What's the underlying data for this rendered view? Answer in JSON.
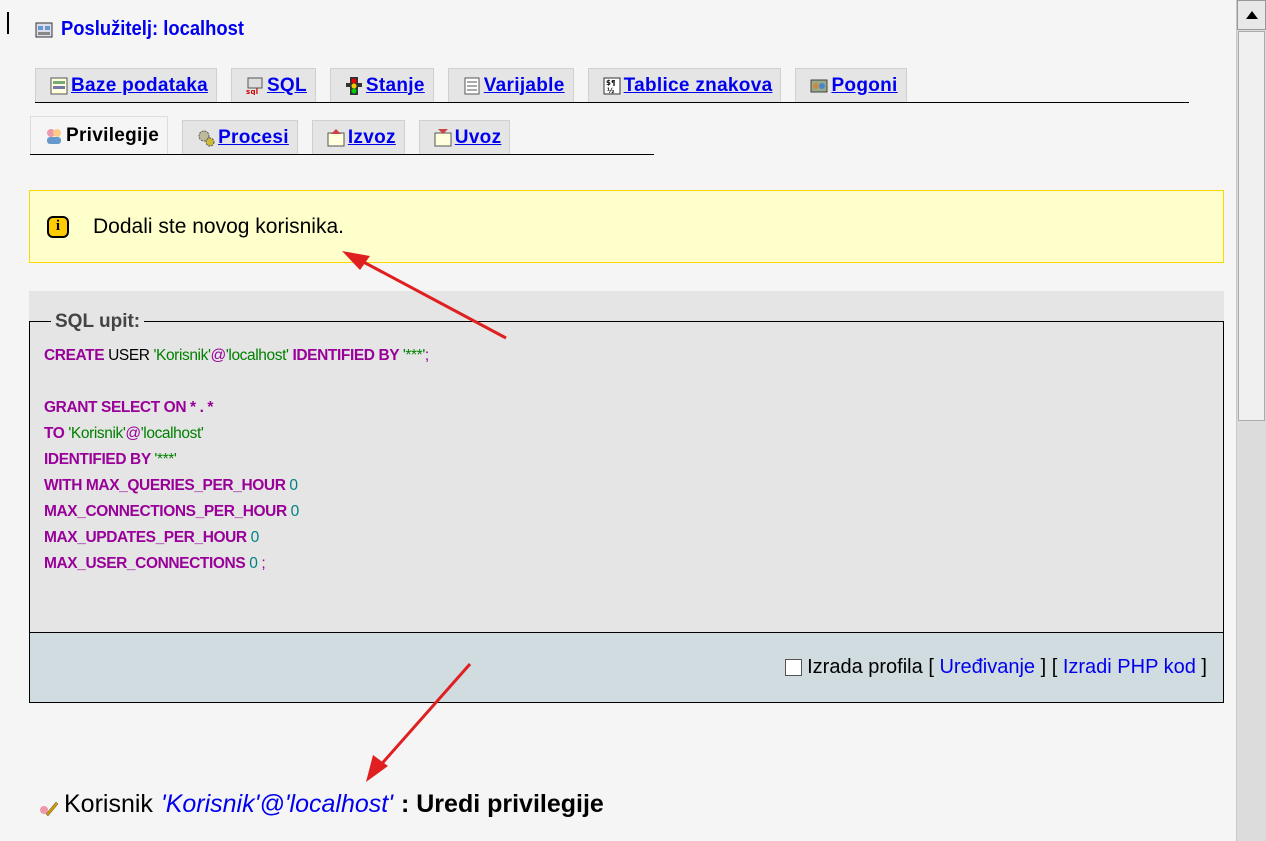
{
  "server": {
    "label": "Poslužitelj: localhost",
    "icon": "server-icon"
  },
  "tabs_row1": [
    {
      "label": "Baze podataka",
      "icon": "database-icon"
    },
    {
      "label": "SQL",
      "icon": "sql-icon"
    },
    {
      "label": "Stanje",
      "icon": "traffic-light-icon"
    },
    {
      "label": "Varijable",
      "icon": "variables-icon"
    },
    {
      "label": "Tablice znakova",
      "icon": "charset-icon"
    },
    {
      "label": "Pogoni",
      "icon": "engines-icon"
    }
  ],
  "tabs_row2": [
    {
      "label": "Privilegije",
      "icon": "privileges-icon",
      "active": true
    },
    {
      "label": "Procesi",
      "icon": "gears-icon"
    },
    {
      "label": "Izvoz",
      "icon": "export-icon"
    },
    {
      "label": "Uvoz",
      "icon": "import-icon"
    }
  ],
  "notice": {
    "message": "Dodali ste novog korisnika."
  },
  "sql": {
    "legend": "SQL upit:",
    "line1": {
      "kw1": "CREATE",
      "p1": " USER ",
      "s1": "'Korisnik'",
      "at": "@",
      "s2": "'localhost'",
      "kw2": " IDENTIFIED BY ",
      "s3": "'***'",
      "end": ";"
    },
    "line2": {
      "kw": "GRANT SELECT ON ",
      "p": "* . *"
    },
    "line3": {
      "kw": "TO ",
      "s1": "'Korisnik'",
      "at": "@",
      "s2": "'localhost'"
    },
    "line4": {
      "kw": "IDENTIFIED BY ",
      "s": "'***'"
    },
    "line5": {
      "kw": "WITH MAX_QUERIES_PER_HOUR ",
      "n": "0"
    },
    "line6": {
      "kw": "MAX_CONNECTIONS_PER_HOUR ",
      "n": "0"
    },
    "line7": {
      "kw": "MAX_UPDATES_PER_HOUR ",
      "n": "0"
    },
    "line8": {
      "kw": "MAX_USER_CONNECTIONS ",
      "n": "0",
      "end": " ;"
    }
  },
  "footer": {
    "profiling_label": "Izrada profila",
    "open": "[ ",
    "edit": "Uređivanje",
    "mid": " ] [ ",
    "php": "Izradi PHP kod",
    "close": " ]"
  },
  "bottom": {
    "prefix": "Korisnik",
    "user": "'Korisnik'@'localhost'",
    "suffix": ": Uredi privilegije"
  },
  "colors": {
    "link": "#0000ee",
    "keyword": "#990099",
    "string": "#008000",
    "number": "#008080",
    "notice_bg": "#ffffcc",
    "arrow": "#e02020"
  }
}
